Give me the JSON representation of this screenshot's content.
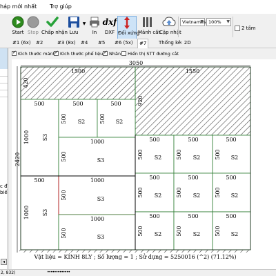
{
  "menu": {
    "items": [
      "háp mới nhất",
      "Trợ giúp"
    ]
  },
  "toolbar": {
    "start": "Start",
    "stop": "Stop",
    "accept": "Chấp nhận",
    "save": "Lưu",
    "print": "In",
    "dxf": "DXF",
    "swap": "Đối xứng",
    "sheet": "Mảnh cắt",
    "update": "Cập nhật",
    "language": "Vietnames",
    "zoom": "100%",
    "two_sheets": "2 tấm",
    "colors": {
      "start": "#2e8b1e",
      "stop": "#9a9a9a",
      "accept": "#27a23a",
      "save": "#1c4e9e",
      "swap": "#cc2222",
      "update": "#5a8dcf"
    }
  },
  "tabs": [
    {
      "label": "#1 (6x)",
      "active": false
    },
    {
      "label": "#2",
      "active": false
    },
    {
      "label": "#3 (8x)",
      "active": false
    },
    {
      "label": "#4",
      "active": false
    },
    {
      "label": "#5",
      "active": false
    },
    {
      "label": "#6 (5x)",
      "active": false
    },
    {
      "label": "#7",
      "active": true
    },
    {
      "label": "Thống kê: 2D",
      "active": false
    }
  ],
  "options": [
    {
      "label": "Kích thước mảnh",
      "checked": true
    },
    {
      "label": "Kích thước phế liệu",
      "checked": true
    },
    {
      "label": "Nhãn",
      "checked": true
    },
    {
      "label": "Hiển thị STT đường cắt",
      "checked": false
    }
  ],
  "left_panel": {
    "text_lines": [
      "c đ",
      "biến"
    ]
  },
  "drawing": {
    "sheet_width": "3050",
    "sheet_height": "2420",
    "dims": {
      "scrap_top_left_width": "1500",
      "scrap_top_right_width": "1550",
      "scrap_top_left_height": "420",
      "scrap_right_height": "920",
      "left_col_width": "500",
      "left_col_height": "1000",
      "piece_w": "500",
      "piece_h": "500",
      "wide_w": "1000"
    },
    "labels": {
      "s2": "S2",
      "s3": "S3"
    },
    "footer": "Vật liệu = KÍNH 8LY ; Số lượng = 1 ; Sử dụng = 5250016 (^2) (71.12%)"
  },
  "status": {
    "coords": "2, 832)",
    "progress": "•••••••••••••"
  }
}
